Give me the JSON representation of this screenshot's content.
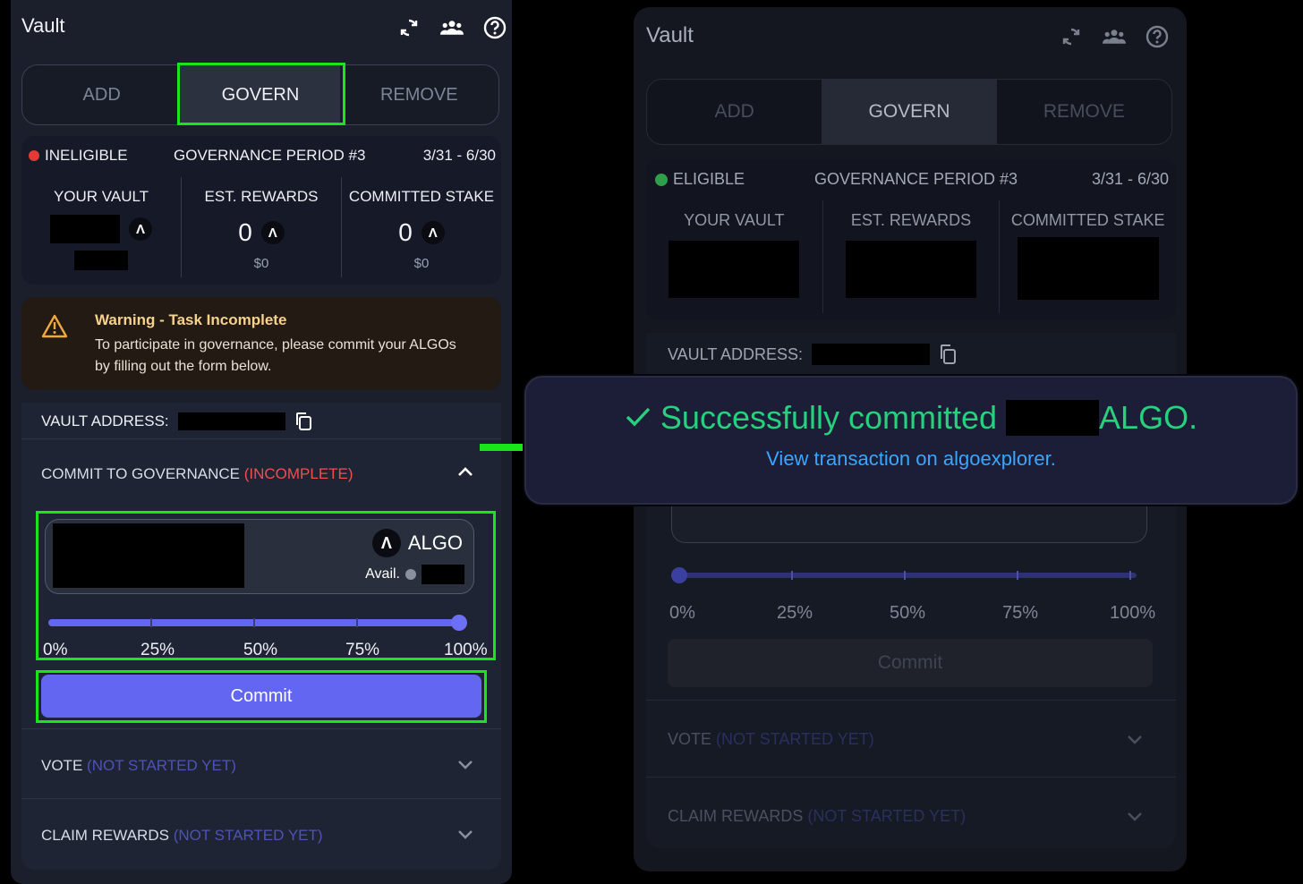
{
  "left": {
    "title": "Vault",
    "icons": [
      "refresh-icon",
      "community-icon",
      "help-icon"
    ],
    "tabs": {
      "add": "ADD",
      "govern": "GOVERN",
      "remove": "REMOVE"
    },
    "status": {
      "label": "INELIGIBLE",
      "color": "#e53935",
      "period": "GOVERNANCE PERIOD #3",
      "dates": "3/31 - 6/30"
    },
    "stats": {
      "your_vault": {
        "label": "YOUR VAULT"
      },
      "est_rewards": {
        "label": "EST. REWARDS",
        "value": "0",
        "usd": "$0"
      },
      "committed_stake": {
        "label": "COMMITTED STAKE",
        "value": "0",
        "usd": "$0"
      }
    },
    "warning": {
      "title": "Warning - Task Incomplete",
      "body": "To participate in governance, please commit your ALGOs by filling out the form below."
    },
    "vault_address_label": "VAULT ADDRESS:",
    "commit_section": {
      "label": "COMMIT TO GOVERNANCE",
      "status": "(INCOMPLETE)"
    },
    "amount": {
      "currency": "ALGO",
      "avail_label": "Avail."
    },
    "slider": {
      "value_percent": 100,
      "marks": [
        "0%",
        "25%",
        "50%",
        "75%",
        "100%"
      ]
    },
    "commit_button": "Commit",
    "vote_section": {
      "label": "VOTE",
      "status": "(NOT STARTED YET)"
    },
    "claim_section": {
      "label": "CLAIM REWARDS",
      "status": "(NOT STARTED YET)"
    }
  },
  "right": {
    "title": "Vault",
    "tabs": {
      "add": "ADD",
      "govern": "GOVERN",
      "remove": "REMOVE"
    },
    "status": {
      "label": "ELIGIBLE",
      "color": "#2e9e4a",
      "period": "GOVERNANCE PERIOD #3",
      "dates": "3/31 - 6/30"
    },
    "stats": {
      "your_vault": "YOUR VAULT",
      "est_rewards": "EST. REWARDS",
      "committed_stake": "COMMITTED STAKE"
    },
    "vault_address_label": "VAULT ADDRESS:",
    "slider": {
      "value_percent": 0,
      "marks": [
        "0%",
        "25%",
        "50%",
        "75%",
        "100%"
      ]
    },
    "commit_button": "Commit",
    "vote_section": {
      "label": "VOTE",
      "status": "(NOT STARTED YET)"
    },
    "claim_section": {
      "label": "CLAIM REWARDS",
      "status": "(NOT STARTED YET)"
    }
  },
  "toast": {
    "message_prefix": "Successfully committed",
    "message_suffix": "ALGO.",
    "link": "View transaction on algoexplorer."
  },
  "colors": {
    "highlight": "#19e619",
    "accent": "#6366f1",
    "success": "#26d07c",
    "link": "#39a7ff"
  }
}
